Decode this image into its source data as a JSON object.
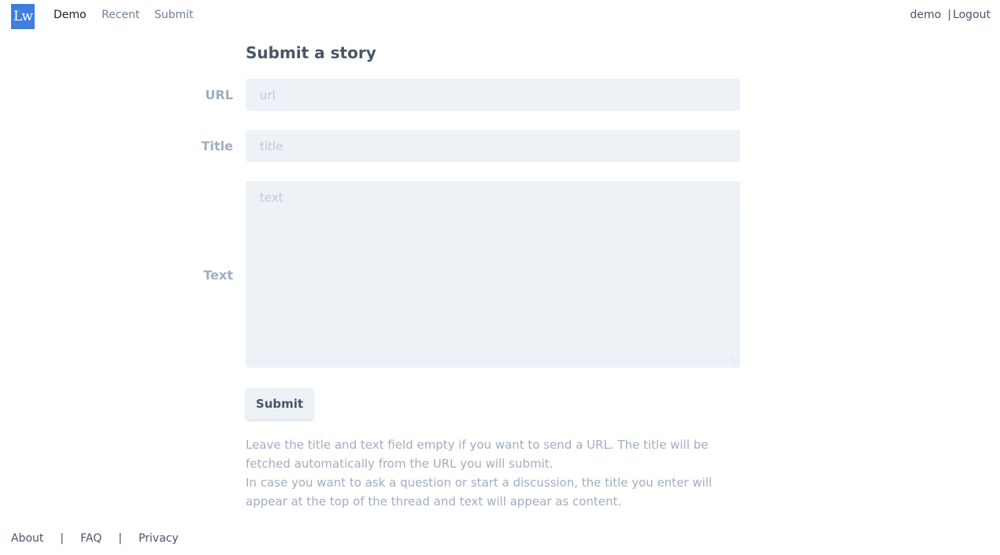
{
  "header": {
    "logo_text": "Lw",
    "nav": [
      {
        "label": "Demo",
        "active": true
      },
      {
        "label": "Recent",
        "active": false
      },
      {
        "label": "Submit",
        "active": false
      }
    ],
    "username": "demo",
    "separator": "|",
    "logout_label": "Logout"
  },
  "form": {
    "title": "Submit a story",
    "url": {
      "label": "URL",
      "placeholder": "url",
      "value": ""
    },
    "story_title": {
      "label": "Title",
      "placeholder": "title",
      "value": ""
    },
    "text": {
      "label": "Text",
      "placeholder": "text",
      "value": ""
    },
    "submit_label": "Submit",
    "help": [
      "Leave the title and text field empty if you want to send a URL. The title will be fetched automatically from the URL you will submit.",
      "In case you want to ask a question or start a discussion, the title you enter will appear at the top of the thread and text will appear as content."
    ]
  },
  "footer": {
    "links": [
      "About",
      "FAQ",
      "Privacy"
    ],
    "separator": "|"
  },
  "colors": {
    "accent": "#3f7fd9",
    "field_bg": "#edf2f7",
    "label": "#a0aec0",
    "text": "#4a5568"
  }
}
